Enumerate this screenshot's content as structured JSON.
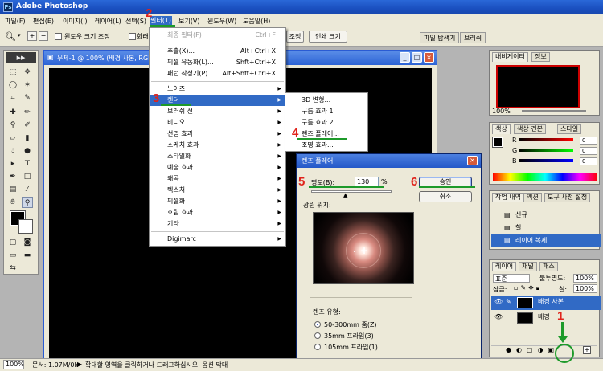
{
  "app": {
    "title": "Adobe Photoshop"
  },
  "menubar": [
    "파일(F)",
    "편집(E)",
    "이미지(I)",
    "레이어(L)",
    "선택(S)",
    "필터(T)",
    "보기(V)",
    "윈도우(W)",
    "도움말(H)"
  ],
  "options": {
    "fit_window_label": "윈도우 크기 조정",
    "fill_label": "화래",
    "adjust_btn": "조정",
    "print_size_btn": "인쇄 크기",
    "tabs": [
      "파일 탐색기",
      "브러쉬"
    ]
  },
  "document": {
    "title": "무제-1 @ 100% (배경 사본, RGB"
  },
  "filter_menu": {
    "items": [
      {
        "label": "최종 필터(F)",
        "shortcut": "Ctrl+F",
        "disabled": true
      },
      {
        "label": "추출(X)...",
        "shortcut": "Alt+Ctrl+X"
      },
      {
        "label": "픽셀 유동화(L)...",
        "shortcut": "Shft+Ctrl+X"
      },
      {
        "label": "패턴 작성기(P)...",
        "shortcut": "Alt+Shft+Ctrl+X"
      },
      {
        "label": "노이즈"
      },
      {
        "label": "렌더",
        "highlighted": true
      },
      {
        "label": "브러쉬 선"
      },
      {
        "label": "비디오"
      },
      {
        "label": "선명 효과"
      },
      {
        "label": "스케치 효과"
      },
      {
        "label": "스타일화"
      },
      {
        "label": "예술 효과"
      },
      {
        "label": "왜곡"
      },
      {
        "label": "텍스처"
      },
      {
        "label": "픽셀화"
      },
      {
        "label": "흐림 효과"
      },
      {
        "label": "기타"
      },
      {
        "label": "Digimarc"
      }
    ]
  },
  "render_submenu": {
    "items": [
      {
        "label": "3D 변형..."
      },
      {
        "label": "구름 효과 1"
      },
      {
        "label": "구름 효과 2"
      },
      {
        "label": "렌즈 플레어...",
        "highlighted": true
      },
      {
        "label": "조명 효과..."
      }
    ]
  },
  "lens_flare_dialog": {
    "title": "렌즈 플레어",
    "brightness_label": "명도(B):",
    "brightness_value": "130",
    "brightness_unit": "%",
    "brightness_fraction": 0.43,
    "flare_center_label": "광원 위치:",
    "ok_label": "승인",
    "cancel_label": "취소",
    "lens_type_label": "렌즈 유형:",
    "lens_types": [
      {
        "label": "50-300mm 줌(Z)",
        "selected": true
      },
      {
        "label": "35mm 프라임(3)",
        "selected": false
      },
      {
        "label": "105mm 프라임(1)",
        "selected": false
      }
    ]
  },
  "navigator": {
    "tabs": [
      "내비게이터",
      "정보"
    ],
    "zoom": "100%"
  },
  "color_panel": {
    "tabs": [
      "색상",
      "색상 견본",
      "스타일"
    ],
    "channels": [
      {
        "name": "R",
        "value": "0"
      },
      {
        "name": "G",
        "value": "0"
      },
      {
        "name": "B",
        "value": "0"
      }
    ]
  },
  "history_panel": {
    "tabs": [
      "작업 내역",
      "액션",
      "도구 사전 설정"
    ],
    "items": [
      "신규",
      "칠",
      "레이어 복제"
    ]
  },
  "layers_panel": {
    "tabs": [
      "레이어",
      "채널",
      "패스"
    ],
    "blend_mode": "표준",
    "opacity_label": "불투명도:",
    "opacity_value": "100%",
    "lock_label": "잠금:",
    "fill_label": "칠:",
    "fill_value": "100%",
    "layers": [
      {
        "name": "배경 사본",
        "selected": true
      },
      {
        "name": "배경",
        "selected": false
      }
    ]
  },
  "status": {
    "zoom": "100%",
    "doc_info": "문서: 1.07M/0k",
    "hint": "확대할 영역을 클릭하거나 드래그하십시오. 옵션 막대"
  },
  "annotations": [
    "1",
    "2",
    "3",
    "4",
    "5",
    "6"
  ],
  "colors": {
    "annotation": "#e0231b",
    "underline": "#1d9a2a",
    "highlight": "#316ac5"
  }
}
